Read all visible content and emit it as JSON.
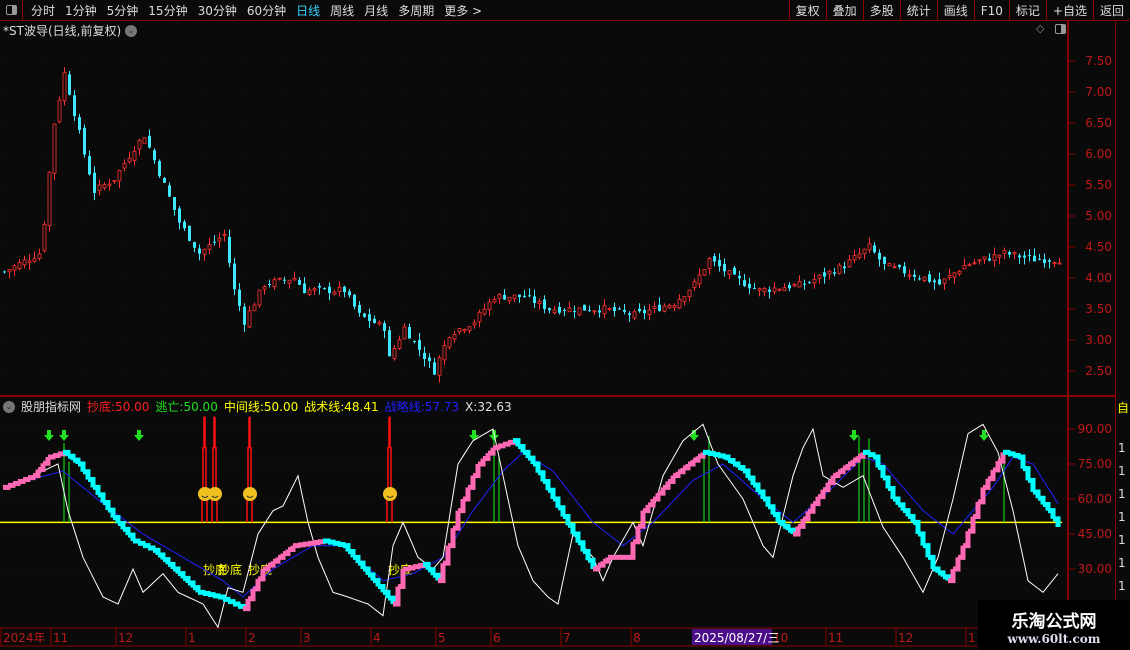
{
  "toolbar": {
    "periods": [
      "分时",
      "1分钟",
      "5分钟",
      "15分钟",
      "30分钟",
      "60分钟",
      "日线",
      "周线",
      "月线",
      "多周期",
      "更多 >"
    ],
    "active": "日线",
    "right_buttons": [
      "复权",
      "叠加",
      "多股",
      "统计",
      "画线",
      "F10",
      "标记",
      "+自选",
      "返回"
    ]
  },
  "chart_title": "*ST波导(日线,前复权)",
  "price_axis": [
    "7.50",
    "7.00",
    "6.50",
    "6.00",
    "5.50",
    "5.00",
    "4.50",
    "4.00",
    "3.50",
    "3.00",
    "2.50"
  ],
  "indicator": {
    "name": "股朋指标网",
    "items": [
      {
        "label": "抄底:",
        "value": "50.00",
        "color": "#ff2020"
      },
      {
        "label": "逃亡:",
        "value": "50.00",
        "color": "#20e020"
      },
      {
        "label": "中间线:",
        "value": "50.00",
        "color": "#ffff00"
      },
      {
        "label": "战术线:",
        "value": "48.41",
        "color": "#ffff00"
      },
      {
        "label": "战略线:",
        "value": "57.73",
        "color": "#2020ff"
      },
      {
        "label": "X:",
        "value": "32.63",
        "color": "#e0e0e0"
      }
    ],
    "axis": [
      "90.00",
      "75.00",
      "60.00",
      "45.00",
      "30.00"
    ],
    "signal_text": "抄底"
  },
  "time_axis": {
    "labels": [
      {
        "t": "2024年",
        "bar": 0
      },
      {
        "t": "11",
        "bar": 10
      },
      {
        "t": "12",
        "bar": 23
      },
      {
        "t": "1",
        "bar": 37
      },
      {
        "t": "2",
        "bar": 49
      },
      {
        "t": "3",
        "bar": 60
      },
      {
        "t": "4",
        "bar": 74
      },
      {
        "t": "5",
        "bar": 87
      },
      {
        "t": "6",
        "bar": 98
      },
      {
        "t": "7",
        "bar": 112
      },
      {
        "t": "8",
        "bar": 126
      },
      {
        "t": "10",
        "bar": 154
      },
      {
        "t": "11",
        "bar": 165
      },
      {
        "t": "12",
        "bar": 179
      },
      {
        "t": "1",
        "bar": 193
      }
    ],
    "cursor_date": "2025/08/27/三",
    "cursor_bar": 138
  },
  "right_strip": {
    "label": "自",
    "values": [
      "1",
      "1",
      "1",
      "1",
      "1",
      "1",
      "1",
      "1"
    ]
  },
  "watermark": {
    "title": "乐淘公式网",
    "url": "www.60lt.com"
  },
  "colors": {
    "up": "#ff3030",
    "down": "#40e8ff",
    "bg": "#0a0a0a",
    "grid": "#8b0000",
    "midline": "#ffff00",
    "strategy": "#2020ff",
    "x_line": "#ffffff",
    "rise": "#ff69b4",
    "fall": "#00ffff"
  },
  "chart_data": {
    "type": "candlestick+indicator",
    "price_range": [
      2.3,
      7.9
    ],
    "close_keypoints": [
      [
        0,
        4.1
      ],
      [
        7,
        4.4
      ],
      [
        8,
        4.9
      ],
      [
        10,
        6.5
      ],
      [
        12,
        7.3
      ],
      [
        13,
        7.0
      ],
      [
        16,
        6.0
      ],
      [
        18,
        5.4
      ],
      [
        22,
        5.6
      ],
      [
        26,
        6.1
      ],
      [
        28,
        6.3
      ],
      [
        32,
        5.5
      ],
      [
        35,
        4.9
      ],
      [
        39,
        4.4
      ],
      [
        44,
        4.7
      ],
      [
        46,
        3.8
      ],
      [
        48,
        3.3
      ],
      [
        52,
        3.9
      ],
      [
        58,
        4.0
      ],
      [
        60,
        3.8
      ],
      [
        68,
        3.8
      ],
      [
        71,
        3.4
      ],
      [
        76,
        3.2
      ],
      [
        77,
        2.7
      ],
      [
        80,
        3.2
      ],
      [
        86,
        2.5
      ],
      [
        89,
        3.1
      ],
      [
        94,
        3.3
      ],
      [
        98,
        3.7
      ],
      [
        104,
        3.7
      ],
      [
        109,
        3.5
      ],
      [
        120,
        3.5
      ],
      [
        126,
        3.4
      ],
      [
        134,
        3.6
      ],
      [
        138,
        3.9
      ],
      [
        141,
        4.3
      ],
      [
        146,
        4.0
      ],
      [
        151,
        3.8
      ],
      [
        160,
        3.9
      ],
      [
        168,
        4.2
      ],
      [
        173,
        4.5
      ],
      [
        176,
        4.2
      ],
      [
        184,
        4.0
      ],
      [
        187,
        3.9
      ],
      [
        192,
        4.2
      ],
      [
        200,
        4.4
      ],
      [
        206,
        4.3
      ],
      [
        212,
        4.3
      ]
    ],
    "indicator_range": [
      15,
      100
    ],
    "x_keypoints": [
      [
        0,
        65
      ],
      [
        6,
        70
      ],
      [
        11,
        75
      ],
      [
        13,
        55
      ],
      [
        16,
        35
      ],
      [
        20,
        18
      ],
      [
        23,
        15
      ],
      [
        26,
        30
      ],
      [
        28,
        20
      ],
      [
        32,
        28
      ],
      [
        35,
        20
      ],
      [
        40,
        15
      ],
      [
        43,
        5
      ],
      [
        45,
        22
      ],
      [
        48,
        20
      ],
      [
        51,
        45
      ],
      [
        54,
        55
      ],
      [
        56,
        57
      ],
      [
        59,
        70
      ],
      [
        61,
        50
      ],
      [
        63,
        35
      ],
      [
        66,
        20
      ],
      [
        69,
        18
      ],
      [
        73,
        15
      ],
      [
        76,
        10
      ],
      [
        78,
        40
      ],
      [
        80,
        50
      ],
      [
        83,
        35
      ],
      [
        86,
        30
      ],
      [
        88,
        35
      ],
      [
        91,
        75
      ],
      [
        94,
        85
      ],
      [
        98,
        90
      ],
      [
        101,
        60
      ],
      [
        103,
        40
      ],
      [
        106,
        25
      ],
      [
        109,
        18
      ],
      [
        111,
        15
      ],
      [
        114,
        45
      ],
      [
        118,
        35
      ],
      [
        120,
        25
      ],
      [
        122,
        35
      ],
      [
        126,
        50
      ],
      [
        128,
        40
      ],
      [
        132,
        70
      ],
      [
        136,
        85
      ],
      [
        140,
        92
      ],
      [
        143,
        75
      ],
      [
        148,
        60
      ],
      [
        152,
        40
      ],
      [
        154,
        35
      ],
      [
        158,
        70
      ],
      [
        160,
        82
      ],
      [
        162,
        90
      ],
      [
        164,
        70
      ],
      [
        168,
        65
      ],
      [
        172,
        70
      ],
      [
        176,
        48
      ],
      [
        180,
        35
      ],
      [
        184,
        20
      ],
      [
        187,
        35
      ],
      [
        190,
        60
      ],
      [
        193,
        88
      ],
      [
        196,
        92
      ],
      [
        199,
        80
      ],
      [
        202,
        55
      ],
      [
        205,
        25
      ],
      [
        208,
        20
      ],
      [
        211,
        28
      ]
    ],
    "tactic_keypoints": [
      [
        0,
        65
      ],
      [
        6,
        70
      ],
      [
        9,
        78
      ],
      [
        12,
        80
      ],
      [
        15,
        75
      ],
      [
        18,
        65
      ],
      [
        22,
        52
      ],
      [
        26,
        42
      ],
      [
        30,
        38
      ],
      [
        34,
        30
      ],
      [
        39,
        20
      ],
      [
        43,
        18
      ],
      [
        48,
        13
      ],
      [
        52,
        30
      ],
      [
        58,
        40
      ],
      [
        64,
        42
      ],
      [
        68,
        40
      ],
      [
        72,
        30
      ],
      [
        76,
        20
      ],
      [
        78,
        15
      ],
      [
        80,
        30
      ],
      [
        84,
        32
      ],
      [
        87,
        25
      ],
      [
        91,
        55
      ],
      [
        95,
        75
      ],
      [
        98,
        82
      ],
      [
        102,
        85
      ],
      [
        106,
        75
      ],
      [
        110,
        60
      ],
      [
        114,
        45
      ],
      [
        118,
        30
      ],
      [
        121,
        35
      ],
      [
        125,
        35
      ],
      [
        128,
        55
      ],
      [
        134,
        70
      ],
      [
        140,
        80
      ],
      [
        144,
        78
      ],
      [
        148,
        72
      ],
      [
        152,
        60
      ],
      [
        155,
        50
      ],
      [
        158,
        45
      ],
      [
        162,
        58
      ],
      [
        166,
        70
      ],
      [
        172,
        80
      ],
      [
        174,
        78
      ],
      [
        178,
        60
      ],
      [
        182,
        50
      ],
      [
        186,
        30
      ],
      [
        189,
        25
      ],
      [
        192,
        40
      ],
      [
        196,
        65
      ],
      [
        200,
        80
      ],
      [
        203,
        78
      ],
      [
        206,
        63
      ],
      [
        209,
        55
      ],
      [
        211,
        48
      ]
    ],
    "strategy_keypoints": [
      [
        0,
        65
      ],
      [
        12,
        72
      ],
      [
        20,
        58
      ],
      [
        28,
        45
      ],
      [
        36,
        35
      ],
      [
        44,
        25
      ],
      [
        48,
        18
      ],
      [
        54,
        30
      ],
      [
        62,
        40
      ],
      [
        68,
        40
      ],
      [
        76,
        25
      ],
      [
        82,
        28
      ],
      [
        88,
        35
      ],
      [
        94,
        55
      ],
      [
        100,
        72
      ],
      [
        104,
        80
      ],
      [
        110,
        72
      ],
      [
        118,
        50
      ],
      [
        124,
        40
      ],
      [
        130,
        50
      ],
      [
        138,
        68
      ],
      [
        144,
        75
      ],
      [
        152,
        60
      ],
      [
        158,
        50
      ],
      [
        166,
        65
      ],
      [
        172,
        78
      ],
      [
        176,
        75
      ],
      [
        184,
        55
      ],
      [
        190,
        45
      ],
      [
        198,
        65
      ],
      [
        202,
        78
      ],
      [
        206,
        75
      ],
      [
        211,
        58
      ]
    ],
    "buy_signals": [
      40,
      42,
      49,
      77
    ],
    "sell_arrows": [
      9,
      12,
      27,
      94,
      98,
      138,
      170,
      196
    ],
    "escape_bars": [
      12,
      13,
      98,
      99,
      140,
      141,
      171,
      172,
      173,
      200
    ]
  }
}
